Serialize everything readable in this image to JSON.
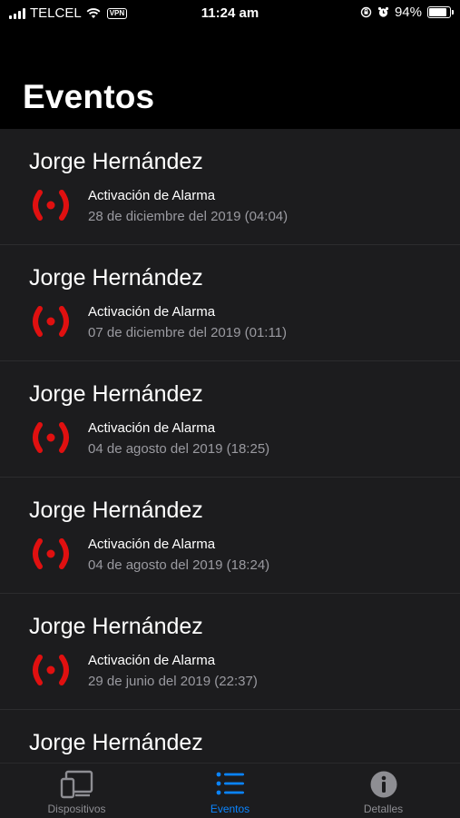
{
  "status_bar": {
    "carrier": "TELCEL",
    "vpn": "VPN",
    "time": "11:24 am",
    "battery": "94%",
    "battery_level": 0.94
  },
  "header": {
    "title": "Eventos"
  },
  "events": [
    {
      "name": "Jorge Hernández",
      "type": "Activación de Alarma",
      "date": "28 de diciembre del 2019 (04:04)"
    },
    {
      "name": "Jorge Hernández",
      "type": "Activación de Alarma",
      "date": "07 de diciembre del 2019 (01:11)"
    },
    {
      "name": "Jorge Hernández",
      "type": "Activación de Alarma",
      "date": "04 de agosto del 2019 (18:25)"
    },
    {
      "name": "Jorge Hernández",
      "type": "Activación de Alarma",
      "date": "04 de agosto del 2019 (18:24)"
    },
    {
      "name": "Jorge Hernández",
      "type": "Activación de Alarma",
      "date": "29 de junio del 2019 (22:37)"
    },
    {
      "name": "Jorge Hernández"
    }
  ],
  "tab_bar": {
    "tabs": [
      {
        "label": "Dispositivos",
        "icon": "devices-icon",
        "active": false
      },
      {
        "label": "Eventos",
        "icon": "list-icon",
        "active": true
      },
      {
        "label": "Detalles",
        "icon": "info-icon",
        "active": false
      }
    ]
  },
  "colors": {
    "accent": "#0a84ff",
    "alarm": "#e01010",
    "background": "#000000",
    "list_background": "#1c1c1e"
  }
}
